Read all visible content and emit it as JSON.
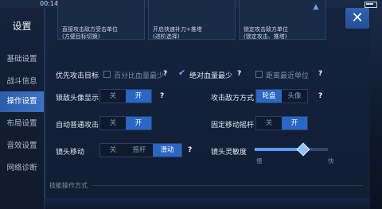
{
  "status": {
    "time": "00:14"
  },
  "sidebar": {
    "title": "设置",
    "items": [
      {
        "label": "基础设置",
        "active": false
      },
      {
        "label": "战斗信息",
        "active": false
      },
      {
        "label": "操作设置",
        "active": true
      },
      {
        "label": "布局设置",
        "active": false
      },
      {
        "label": "音效设置",
        "active": false
      },
      {
        "label": "网络诊断",
        "active": false
      }
    ]
  },
  "cards": [
    {
      "line1": "直接攻击敌方受击单位",
      "line2": "(方便目标切换)"
    },
    {
      "line1": "开启快速补刀+推塔",
      "line2": "(进阶选择)"
    },
    {
      "line1": "锁定攻击敌方单位",
      "line2": "(锁定攻击、推塔)"
    }
  ],
  "close_icon": "close-icon",
  "priority": {
    "label": "优先攻击目标",
    "options": [
      {
        "label": "百分比血量最少",
        "checked": false
      },
      {
        "label": "绝对血量最少",
        "checked": true
      },
      {
        "label": "距离最近单位",
        "checked": false
      }
    ]
  },
  "enemy_avatar": {
    "label": "锁敌头像显示",
    "options": [
      "关",
      "开"
    ],
    "selected": "开"
  },
  "attack_enemy": {
    "label": "攻击敌方方式",
    "options": [
      "轮盘",
      "头像"
    ],
    "selected": "轮盘"
  },
  "auto_attack": {
    "label": "自动普通攻击",
    "options": [
      "关",
      "开"
    ],
    "selected": "开"
  },
  "fixed_joystick": {
    "label": "固定移动摇杆",
    "options": [
      "关",
      "开"
    ],
    "selected": "开"
  },
  "camera_move": {
    "label": "镜头移动",
    "options": [
      "关",
      "摇杆",
      "滑动"
    ],
    "selected": "滑动"
  },
  "camera_sensitivity": {
    "label": "镜头灵敏度",
    "min_label": "慢",
    "max_label": "快",
    "value": 0.65
  },
  "help_glyph": "?",
  "section": {
    "label": "技能操作方式"
  }
}
